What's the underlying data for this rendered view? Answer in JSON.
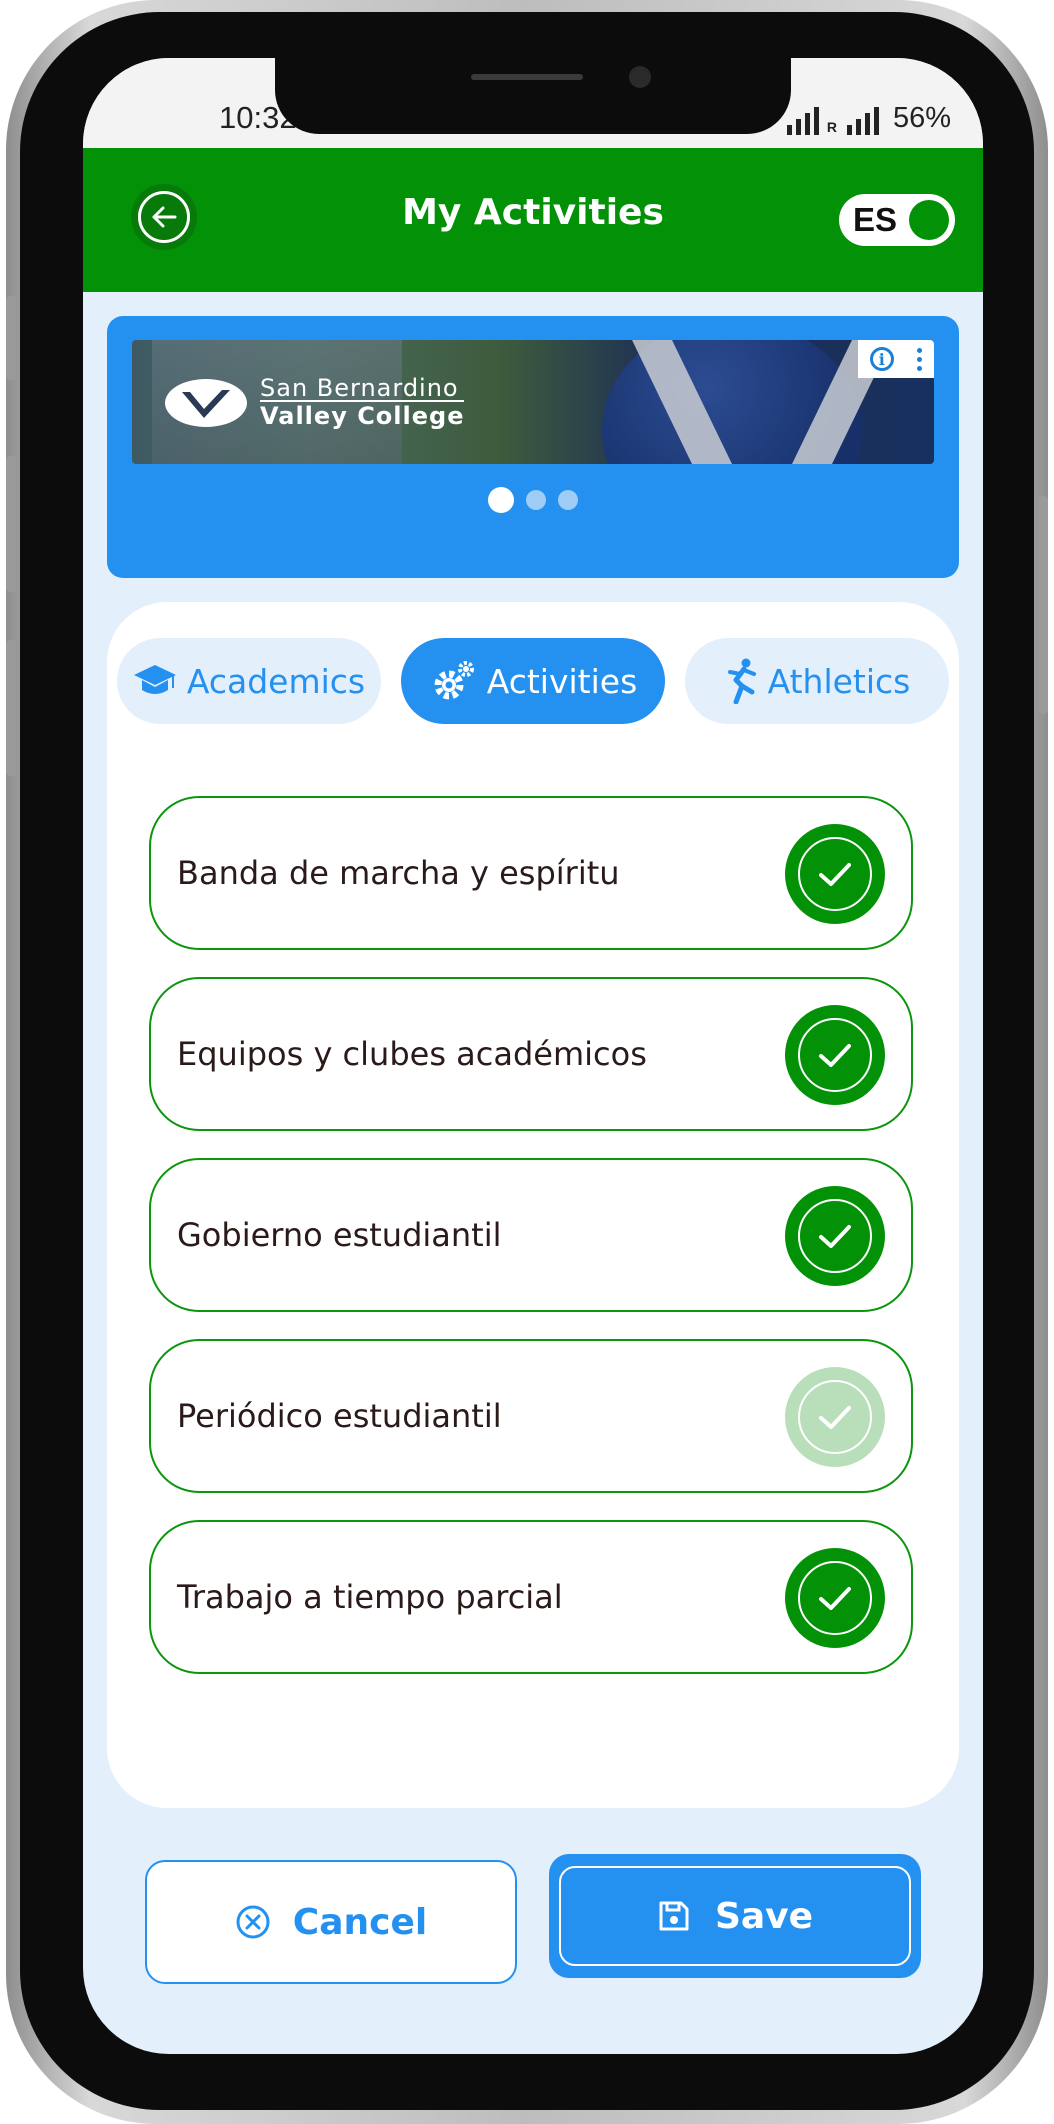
{
  "status_bar": {
    "time": "10:32",
    "battery": "56%",
    "signal_label": "R"
  },
  "app_bar": {
    "title": "My Activities",
    "language_label": "ES",
    "language_toggle_on": true
  },
  "banner": {
    "brand_line1": "San Bernardino",
    "brand_line2": "Valley College",
    "page_count": 3,
    "active_page": 1
  },
  "tabs": [
    {
      "label": "Academics",
      "icon": "graduation-cap-icon",
      "active": false
    },
    {
      "label": "Activities",
      "icon": "gears-icon",
      "active": true
    },
    {
      "label": "Athletics",
      "icon": "runner-icon",
      "active": false
    }
  ],
  "activities": [
    {
      "label": "Banda de marcha y espíritu",
      "checked": true
    },
    {
      "label": "Equipos y clubes académicos",
      "checked": true
    },
    {
      "label": "Gobierno estudiantil",
      "checked": true
    },
    {
      "label": "Periódico estudiantil",
      "checked": false
    },
    {
      "label": "Trabajo a tiempo parcial",
      "checked": true
    }
  ],
  "actions": {
    "cancel_label": "Cancel",
    "save_label": "Save"
  },
  "colors": {
    "primary_green": "#039107",
    "accent_blue": "#2491f1",
    "screen_bg": "#e3effb"
  }
}
